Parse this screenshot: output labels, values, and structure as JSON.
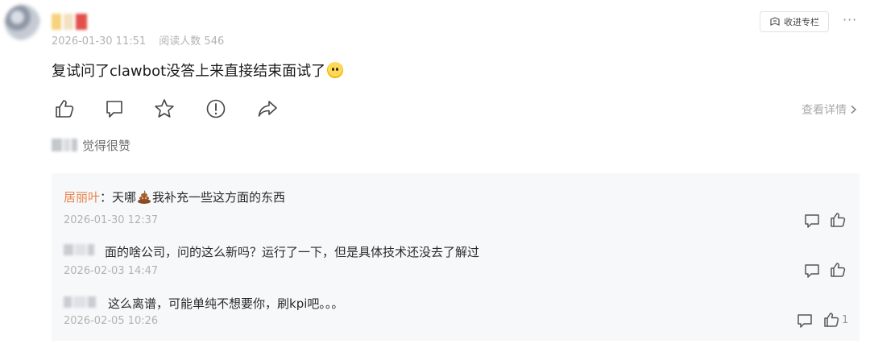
{
  "post": {
    "timestamp": "2026-01-30 11:51",
    "reads_label": "阅读人数 546",
    "text": "复试问了clawbot没答上来直接结束面试了",
    "follow_label": "收进专栏",
    "more_label": "···",
    "details_label": "查看详情",
    "liked_text": "觉得很赞"
  },
  "comments": [
    {
      "author": "居丽叶",
      "colon": "：",
      "text_before_emoji": "天哪",
      "text_after_emoji": "我补充一些这方面的东西",
      "time": "2026-01-30 12:37",
      "emoji_icon": "poop-icon"
    },
    {
      "text": "面的啥公司，问的这么新吗？运行了一下，但是具体技术还没去了解过",
      "time": "2026-02-03 14:47"
    },
    {
      "text": "这么离谱，可能单纯不想要你，刷kpi吧。。。",
      "time": "2026-02-05 10:26",
      "likes": "1"
    }
  ],
  "icons": {
    "actions": [
      "thumbs-up-icon",
      "comment-icon",
      "star-icon",
      "report-icon",
      "share-icon"
    ],
    "follow": "bookmark-icon"
  },
  "colors": {
    "author_name": "#e8834e",
    "meta_text": "#b3b3b3",
    "comment_bg": "#f7f8fa"
  }
}
